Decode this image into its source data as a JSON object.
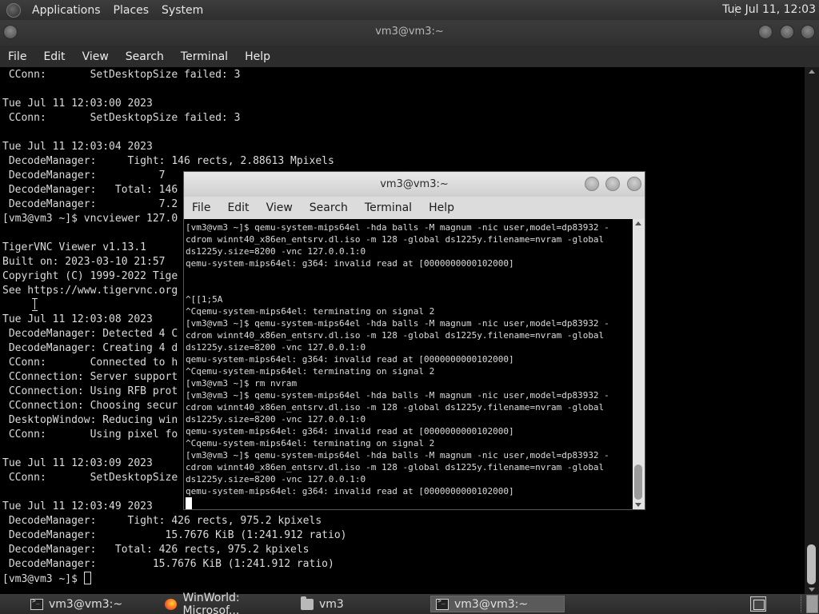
{
  "top_panel": {
    "menus": [
      "Applications",
      "Places",
      "System"
    ],
    "clock": "Tue Jul 11, 12:03"
  },
  "big_window": {
    "title": "vm3@vm3:~",
    "menus": [
      "File",
      "Edit",
      "View",
      "Search",
      "Terminal",
      "Help"
    ],
    "lines": [
      " CConn:       SetDesktopSize failed: 3",
      "",
      "Tue Jul 11 12:03:00 2023",
      " CConn:       SetDesktopSize failed: 3",
      "",
      "Tue Jul 11 12:03:04 2023",
      " DecodeManager:     Tight: 146 rects, 2.88613 Mpixels",
      " DecodeManager:          7",
      " DecodeManager:   Total: 146",
      " DecodeManager:          7.2",
      "[vm3@vm3 ~]$ vncviewer 127.0",
      "",
      "TigerVNC Viewer v1.13.1",
      "Built on: 2023-03-10 21:57",
      "Copyright (C) 1999-2022 Tige",
      "See https://www.tigervnc.org",
      "",
      "Tue Jul 11 12:03:08 2023",
      " DecodeManager: Detected 4 C",
      " DecodeManager: Creating 4 d",
      " CConn:       Connected to h",
      " CConnection: Server support",
      " CConnection: Using RFB prot",
      " CConnection: Choosing secur",
      " DesktopWindow: Reducing win",
      " CConn:       Using pixel fo",
      "",
      "Tue Jul 11 12:03:09 2023",
      " CConn:       SetDesktopSize",
      "",
      "Tue Jul 11 12:03:49 2023",
      " DecodeManager:     Tight: 426 rects, 975.2 kpixels",
      " DecodeManager:           15.7676 KiB (1:241.912 ratio)",
      " DecodeManager:   Total: 426 rects, 975.2 kpixels",
      " DecodeManager:         15.7676 KiB (1:241.912 ratio)"
    ],
    "prompt": "[vm3@vm3 ~]$ "
  },
  "small_window": {
    "title": "vm3@vm3:~",
    "menus": [
      "File",
      "Edit",
      "View",
      "Search",
      "Terminal",
      "Help"
    ],
    "lines": [
      "[vm3@vm3 ~]$ qemu-system-mips64el -hda balls -M magnum -nic user,model=dp83932 -",
      "cdrom winnt40_x86en_entsrv.dl.iso -m 128 -global ds1225y.filename=nvram -global",
      "ds1225y.size=8200 -vnc 127.0.0.1:0",
      "qemu-system-mips64el: g364: invalid read at [0000000000102000]",
      "",
      "",
      "^[[1;5A",
      "^Cqemu-system-mips64el: terminating on signal 2",
      "[vm3@vm3 ~]$ qemu-system-mips64el -hda balls -M magnum -nic user,model=dp83932 -",
      "cdrom winnt40_x86en_entsrv.dl.iso -m 128 -global ds1225y.filename=nvram -global",
      "ds1225y.size=8200 -vnc 127.0.0.1:0",
      "qemu-system-mips64el: g364: invalid read at [0000000000102000]",
      "^Cqemu-system-mips64el: terminating on signal 2",
      "[vm3@vm3 ~]$ rm nvram",
      "[vm3@vm3 ~]$ qemu-system-mips64el -hda balls -M magnum -nic user,model=dp83932 -",
      "cdrom winnt40_x86en_entsrv.dl.iso -m 128 -global ds1225y.filename=nvram -global",
      "ds1225y.size=8200 -vnc 127.0.0.1:0",
      "qemu-system-mips64el: g364: invalid read at [0000000000102000]",
      "^Cqemu-system-mips64el: terminating on signal 2",
      "[vm3@vm3 ~]$ qemu-system-mips64el -hda balls -M magnum -nic user,model=dp83932 -",
      "cdrom winnt40_x86en_entsrv.dl.iso -m 128 -global ds1225y.filename=nvram -global",
      "ds1225y.size=8200 -vnc 127.0.0.1:0",
      "qemu-system-mips64el: g364: invalid read at [0000000000102000]"
    ]
  },
  "taskbar": {
    "tasks": [
      {
        "label": "vm3@vm3:~",
        "icon": "terminal-icon"
      },
      {
        "label": "WinWorld: Microsof...",
        "icon": "firefox-icon"
      },
      {
        "label": "vm3",
        "icon": "folder-icon"
      },
      {
        "label": "vm3@vm3:~",
        "icon": "terminal-icon",
        "active": true
      }
    ]
  }
}
